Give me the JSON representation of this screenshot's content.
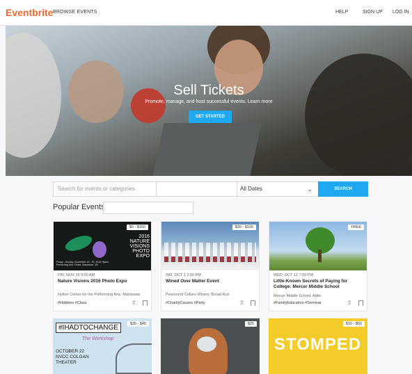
{
  "header": {
    "logo": "Eventbrite",
    "browse": "BROWSE EVENTS",
    "help": "HELP",
    "signup": "SIGN UP",
    "login": "LOG IN"
  },
  "hero": {
    "title": "Sell Tickets",
    "subtitle": "Promote, manage, and host successful events. Learn more",
    "cta": "GET STARTED"
  },
  "search": {
    "placeholder": "Search for events or categories",
    "location": "",
    "dates": "All Dates",
    "button": "SEARCH"
  },
  "popular": {
    "label": "Popular Events in",
    "location": ""
  },
  "events": [
    {
      "price": "$0 - $160",
      "date": "FRI, NOV 18 9:00 AM",
      "title": "Nature Visions 2016 Photo Expo",
      "venue": "Hylton Center for the Performing Arts, Manassas",
      "tags": "#Hobbies  #Class",
      "img_text": "2016 NATURE VISIONS PHOTO EXPO",
      "img_sub": "Friday - Sunday, November 18 - 20, 2016 Hylton Performing Arts Center, Manassas, VA"
    },
    {
      "price": "$30 - $100",
      "date": "SAT, OCT 1 2:00 PM",
      "title": "Wined Over Matter Event",
      "venue": "Pearmund Cellars Winery, Broad Run",
      "tags": "#CharityCauses  #Party"
    },
    {
      "price": "FREE",
      "date": "WED, OCT 12 7:00 PM",
      "title": "Little-Known Secrets of Paying for College: Mercer Middle School",
      "venue": "Mercer Middle School, Aldie",
      "tags": "#FamilyEducation  #Seminar"
    },
    {
      "price": "$35 - $45",
      "img_text": "#IHADTOCHANGE",
      "img_sub": "The Workshop",
      "img_lines": "OCTOBER 22 NVCC COLGAN THEATER"
    },
    {
      "price": "$25"
    },
    {
      "price": "$10 - $50",
      "img_text": "STOMPED"
    }
  ]
}
